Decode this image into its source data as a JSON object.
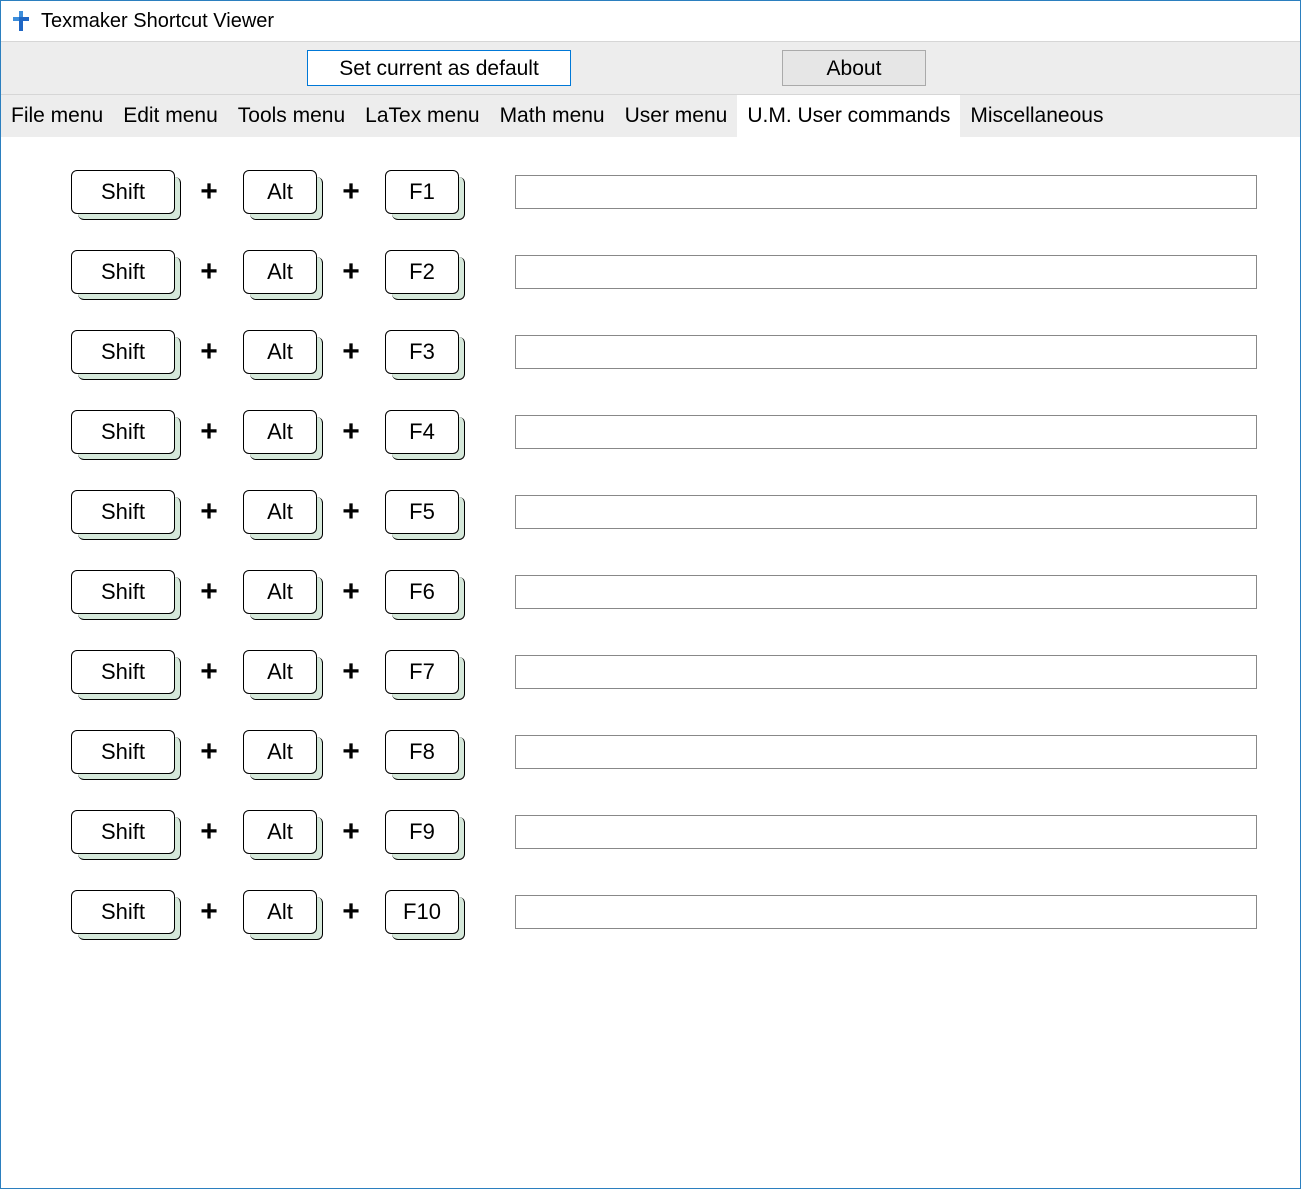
{
  "window": {
    "title": "Texmaker Shortcut Viewer"
  },
  "toolbar": {
    "set_default_label": "Set current as default",
    "about_label": "About"
  },
  "tabs": [
    {
      "label": "File menu",
      "active": false
    },
    {
      "label": "Edit menu",
      "active": false
    },
    {
      "label": "Tools menu",
      "active": false
    },
    {
      "label": "LaTex menu",
      "active": false
    },
    {
      "label": "Math menu",
      "active": false
    },
    {
      "label": "User menu",
      "active": false
    },
    {
      "label": "U.M. User commands",
      "active": true
    },
    {
      "label": "Miscellaneous",
      "active": false
    }
  ],
  "glyphs": {
    "plus": "+"
  },
  "shortcuts": [
    {
      "key1": "Shift",
      "key2": "Alt",
      "key3": "F1",
      "value": ""
    },
    {
      "key1": "Shift",
      "key2": "Alt",
      "key3": "F2",
      "value": ""
    },
    {
      "key1": "Shift",
      "key2": "Alt",
      "key3": "F3",
      "value": ""
    },
    {
      "key1": "Shift",
      "key2": "Alt",
      "key3": "F4",
      "value": ""
    },
    {
      "key1": "Shift",
      "key2": "Alt",
      "key3": "F5",
      "value": ""
    },
    {
      "key1": "Shift",
      "key2": "Alt",
      "key3": "F6",
      "value": ""
    },
    {
      "key1": "Shift",
      "key2": "Alt",
      "key3": "F7",
      "value": ""
    },
    {
      "key1": "Shift",
      "key2": "Alt",
      "key3": "F8",
      "value": ""
    },
    {
      "key1": "Shift",
      "key2": "Alt",
      "key3": "F9",
      "value": ""
    },
    {
      "key1": "Shift",
      "key2": "Alt",
      "key3": "F10",
      "value": ""
    }
  ]
}
